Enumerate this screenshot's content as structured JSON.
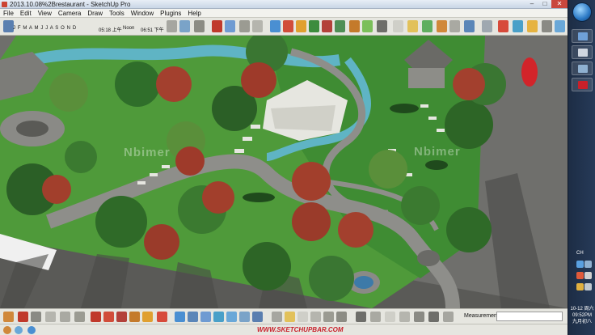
{
  "window": {
    "title": "2013.10.08%2Brestaurant - SketchUp Pro",
    "minimize": "–",
    "maximize": "□",
    "close": "✕"
  },
  "menu": [
    "File",
    "Edit",
    "View",
    "Camera",
    "Draw",
    "Tools",
    "Window",
    "Plugins",
    "Help"
  ],
  "shadow_toolbar": {
    "months": "J F M A M J J A S O N D",
    "sunrise_time": "05:18 上午",
    "noon_label": "Noon",
    "sunset_time": "06:51 下午"
  },
  "viewport": {
    "watermarks": [
      "Nbimer",
      "Nbimer"
    ]
  },
  "bottom_toolbar": {
    "measurements_label": "Measurements",
    "measurements_value": ""
  },
  "statusbar": {
    "site_url": "WWW.SKETCHUPBAR.COM"
  },
  "taskbar": {
    "time": "09:52PM",
    "date": "10-12 周六",
    "lunar": "九月初八",
    "lang": "CH"
  },
  "colors": {
    "grass": "#4f9a3a",
    "path": "#8e8e8a",
    "water": "#5fb4c4",
    "accent_red": "#c8202a"
  }
}
